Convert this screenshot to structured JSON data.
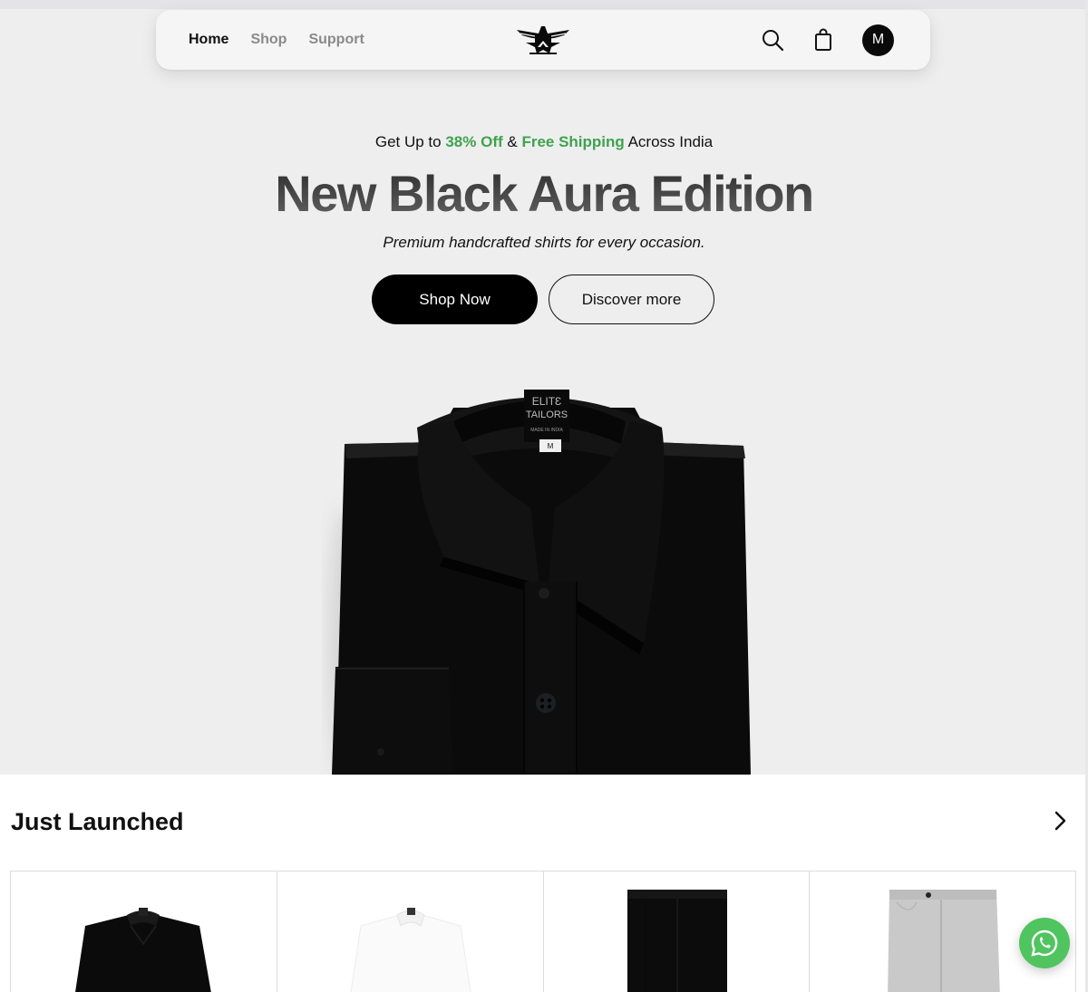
{
  "nav": {
    "links": [
      {
        "label": "Home",
        "active": true
      },
      {
        "label": "Shop",
        "active": false
      },
      {
        "label": "Support",
        "active": false
      }
    ],
    "avatar_initial": "M",
    "icons": [
      "search-icon",
      "shopping-bag-icon",
      "avatar"
    ]
  },
  "hero": {
    "promo": {
      "prefix": "Get Up to",
      "discount": "38% Off",
      "joiner": "&",
      "shipping": "Free Shipping",
      "suffix": "Across India"
    },
    "title": "New Black Aura Edition",
    "subtitle": "Premium handcrafted shirts for every occasion.",
    "primary_button": "Shop Now",
    "secondary_button": "Discover more",
    "product_label": {
      "brand_line1": "ELITƐ",
      "brand_line2": "TAILORS",
      "origin": "MADE IN INDIA",
      "size": "M"
    }
  },
  "just_launched": {
    "heading": "Just Launched",
    "products": [
      {
        "item": "black-shirt"
      },
      {
        "item": "white-shirt"
      },
      {
        "item": "black-trousers"
      },
      {
        "item": "grey-trousers"
      }
    ]
  },
  "colors": {
    "accent_green": "#3fa34d",
    "whatsapp_green": "#4fc45f",
    "hero_bg": "#eeeeef"
  }
}
